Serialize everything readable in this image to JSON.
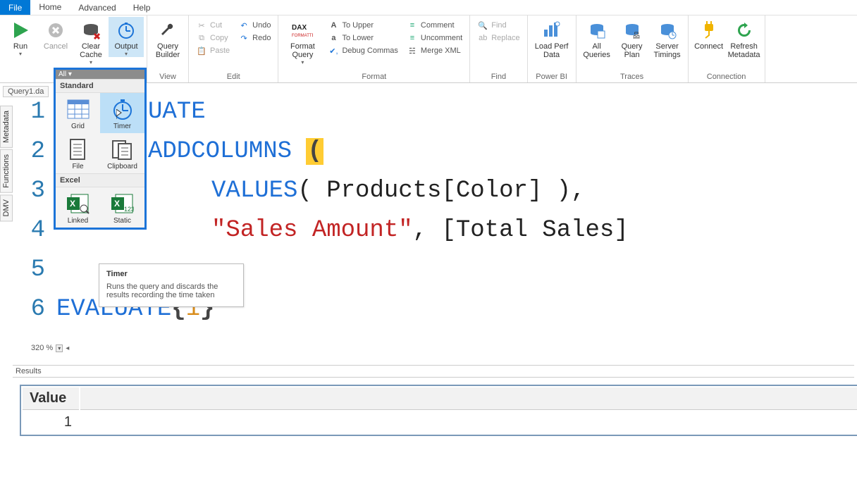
{
  "menu": {
    "file": "File",
    "home": "Home",
    "advanced": "Advanced",
    "help": "Help"
  },
  "ribbon": {
    "run": "Run",
    "cancel": "Cancel",
    "clear_cache": "Clear\nCache",
    "output": "Output",
    "query_builder": "Query\nBuilder",
    "view_group": "View",
    "cut": "Cut",
    "copy": "Copy",
    "paste": "Paste",
    "undo": "Undo",
    "redo": "Redo",
    "edit_group": "Edit",
    "format_query": "Format\nQuery",
    "to_upper": "To Upper",
    "to_lower": "To Lower",
    "debug_commas": "Debug Commas",
    "comment": "Comment",
    "uncomment": "Uncomment",
    "merge_xml": "Merge XML",
    "format_group": "Format",
    "find": "Find",
    "replace": "Replace",
    "find_group": "Find",
    "load_perf": "Load Perf\nData",
    "powerbi_group": "Power BI",
    "all_queries": "All\nQueries",
    "query_plan": "Query\nPlan",
    "server_timings": "Server\nTimings",
    "traces_group": "Traces",
    "connect": "Connect",
    "refresh_meta": "Refresh\nMetadata",
    "connection_group": "Connection"
  },
  "side": {
    "metadata": "Metadata",
    "functions": "Functions",
    "dmv": "DMV"
  },
  "doc_tab": "Query1.da",
  "popover": {
    "header": "All ▾",
    "standard": "Standard",
    "grid": "Grid",
    "timer": "Timer",
    "file": "File",
    "clipboard": "Clipboard",
    "excel": "Excel",
    "linked": "Linked",
    "static": "Static"
  },
  "tooltip": {
    "title": "Timer",
    "body": "Runs the query and discards the results recording the time taken"
  },
  "editor": {
    "zoom": "320 %",
    "lines": {
      "l1_num": "1",
      "l1_a": "UATE",
      "l2_num": "2",
      "l2_a": "ADDCOLUMNS",
      "l2_paren": "(",
      "l3_num": "3",
      "l3_a": "VALUES",
      "l3_b": " ( Products[Color] ),",
      "l4_num": "4",
      "l4_str": "\"Sales Amount\"",
      "l4_rest": ", [Total Sales]",
      "l5_num": "5",
      "l6_num": "6",
      "l6_kw": "EVALUATE",
      "l6_brace_open": " { ",
      "l6_val": "1",
      "l6_brace_close": " }"
    }
  },
  "results": {
    "caption": "Results",
    "header": "Value",
    "row1": "1"
  }
}
